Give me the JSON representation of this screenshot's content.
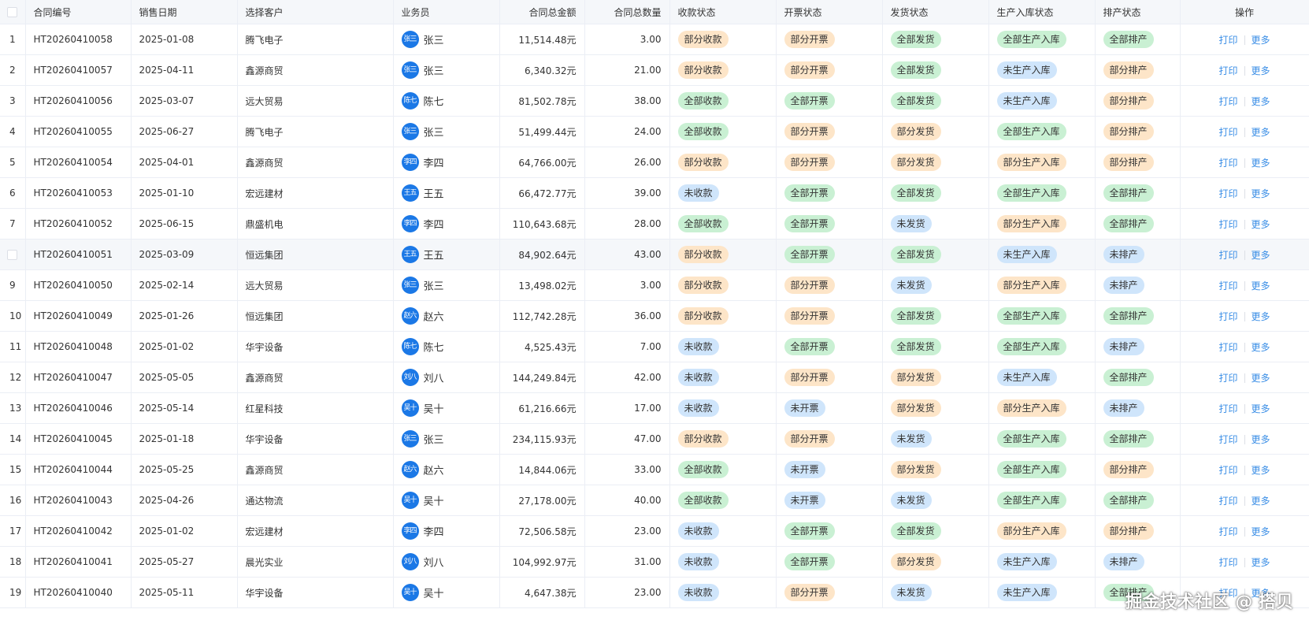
{
  "columns": {
    "contract_no": "合同编号",
    "sale_date": "销售日期",
    "customer": "选择客户",
    "salesperson": "业务员",
    "total_amount": "合同总金额",
    "total_qty": "合同总数量",
    "payment_status": "收款状态",
    "invoice_status": "开票状态",
    "shipping_status": "发货状态",
    "production_status": "生产入库状态",
    "schedule_status": "排产状态",
    "operations": "操作"
  },
  "actions": {
    "print": "打印",
    "more": "更多"
  },
  "status_colors": {
    "orange": "#fde5c8",
    "green": "#c9f0d3",
    "blue": "#cfe5fb",
    "link": "#3a8ee6",
    "avatar": "#1b78e6"
  },
  "rows": [
    {
      "idx": "1",
      "no": "HT20260410058",
      "date": "2025-01-08",
      "customer": "腾飞电子",
      "rep": "张三",
      "amount": "11,514.48元",
      "qty": "3.00",
      "pay": "部分收款",
      "inv": "部分开票",
      "ship": "全部发货",
      "prod": "全部生产入库",
      "sched": "全部排产"
    },
    {
      "idx": "2",
      "no": "HT20260410057",
      "date": "2025-04-11",
      "customer": "鑫源商贸",
      "rep": "张三",
      "amount": "6,340.32元",
      "qty": "21.00",
      "pay": "部分收款",
      "inv": "部分开票",
      "ship": "全部发货",
      "prod": "未生产入库",
      "sched": "部分排产"
    },
    {
      "idx": "3",
      "no": "HT20260410056",
      "date": "2025-03-07",
      "customer": "远大贸易",
      "rep": "陈七",
      "amount": "81,502.78元",
      "qty": "38.00",
      "pay": "全部收款",
      "inv": "全部开票",
      "ship": "全部发货",
      "prod": "未生产入库",
      "sched": "部分排产"
    },
    {
      "idx": "4",
      "no": "HT20260410055",
      "date": "2025-06-27",
      "customer": "腾飞电子",
      "rep": "张三",
      "amount": "51,499.44元",
      "qty": "24.00",
      "pay": "全部收款",
      "inv": "部分开票",
      "ship": "部分发货",
      "prod": "全部生产入库",
      "sched": "部分排产"
    },
    {
      "idx": "5",
      "no": "HT20260410054",
      "date": "2025-04-01",
      "customer": "鑫源商贸",
      "rep": "李四",
      "amount": "64,766.00元",
      "qty": "26.00",
      "pay": "部分收款",
      "inv": "部分开票",
      "ship": "部分发货",
      "prod": "部分生产入库",
      "sched": "部分排产"
    },
    {
      "idx": "6",
      "no": "HT20260410053",
      "date": "2025-01-10",
      "customer": "宏远建材",
      "rep": "王五",
      "amount": "66,472.77元",
      "qty": "39.00",
      "pay": "未收款",
      "inv": "全部开票",
      "ship": "全部发货",
      "prod": "全部生产入库",
      "sched": "全部排产"
    },
    {
      "idx": "7",
      "no": "HT20260410052",
      "date": "2025-06-15",
      "customer": "鼎盛机电",
      "rep": "李四",
      "amount": "110,643.68元",
      "qty": "28.00",
      "pay": "全部收款",
      "inv": "全部开票",
      "ship": "未发货",
      "prod": "部分生产入库",
      "sched": "全部排产"
    },
    {
      "idx": "",
      "no": "HT20260410051",
      "date": "2025-03-09",
      "customer": "恒远集团",
      "rep": "王五",
      "amount": "84,902.64元",
      "qty": "43.00",
      "pay": "部分收款",
      "inv": "全部开票",
      "ship": "全部发货",
      "prod": "未生产入库",
      "sched": "未排产",
      "checkbox": true
    },
    {
      "idx": "9",
      "no": "HT20260410050",
      "date": "2025-02-14",
      "customer": "远大贸易",
      "rep": "张三",
      "amount": "13,498.02元",
      "qty": "3.00",
      "pay": "部分收款",
      "inv": "部分开票",
      "ship": "未发货",
      "prod": "部分生产入库",
      "sched": "未排产"
    },
    {
      "idx": "10",
      "no": "HT20260410049",
      "date": "2025-01-26",
      "customer": "恒远集团",
      "rep": "赵六",
      "amount": "112,742.28元",
      "qty": "36.00",
      "pay": "部分收款",
      "inv": "部分开票",
      "ship": "全部发货",
      "prod": "全部生产入库",
      "sched": "全部排产"
    },
    {
      "idx": "11",
      "no": "HT20260410048",
      "date": "2025-01-02",
      "customer": "华宇设备",
      "rep": "陈七",
      "amount": "4,525.43元",
      "qty": "7.00",
      "pay": "未收款",
      "inv": "全部开票",
      "ship": "全部发货",
      "prod": "全部生产入库",
      "sched": "未排产"
    },
    {
      "idx": "12",
      "no": "HT20260410047",
      "date": "2025-05-05",
      "customer": "鑫源商贸",
      "rep": "刘八",
      "amount": "144,249.84元",
      "qty": "42.00",
      "pay": "未收款",
      "inv": "部分开票",
      "ship": "部分发货",
      "prod": "未生产入库",
      "sched": "全部排产"
    },
    {
      "idx": "13",
      "no": "HT20260410046",
      "date": "2025-05-14",
      "customer": "红星科技",
      "rep": "吴十",
      "amount": "61,216.66元",
      "qty": "17.00",
      "pay": "未收款",
      "inv": "未开票",
      "ship": "部分发货",
      "prod": "部分生产入库",
      "sched": "未排产"
    },
    {
      "idx": "14",
      "no": "HT20260410045",
      "date": "2025-01-18",
      "customer": "华宇设备",
      "rep": "张三",
      "amount": "234,115.93元",
      "qty": "47.00",
      "pay": "部分收款",
      "inv": "部分开票",
      "ship": "未发货",
      "prod": "全部生产入库",
      "sched": "全部排产"
    },
    {
      "idx": "15",
      "no": "HT20260410044",
      "date": "2025-05-25",
      "customer": "鑫源商贸",
      "rep": "赵六",
      "amount": "14,844.06元",
      "qty": "33.00",
      "pay": "全部收款",
      "inv": "未开票",
      "ship": "部分发货",
      "prod": "全部生产入库",
      "sched": "部分排产"
    },
    {
      "idx": "16",
      "no": "HT20260410043",
      "date": "2025-04-26",
      "customer": "通达物流",
      "rep": "吴十",
      "amount": "27,178.00元",
      "qty": "40.00",
      "pay": "全部收款",
      "inv": "未开票",
      "ship": "未发货",
      "prod": "全部生产入库",
      "sched": "全部排产"
    },
    {
      "idx": "17",
      "no": "HT20260410042",
      "date": "2025-01-02",
      "customer": "宏远建材",
      "rep": "李四",
      "amount": "72,506.58元",
      "qty": "23.00",
      "pay": "未收款",
      "inv": "全部开票",
      "ship": "全部发货",
      "prod": "部分生产入库",
      "sched": "部分排产"
    },
    {
      "idx": "18",
      "no": "HT20260410041",
      "date": "2025-05-27",
      "customer": "晨光实业",
      "rep": "刘八",
      "amount": "104,992.97元",
      "qty": "31.00",
      "pay": "未收款",
      "inv": "全部开票",
      "ship": "部分发货",
      "prod": "未生产入库",
      "sched": "未排产"
    },
    {
      "idx": "19",
      "no": "HT20260410040",
      "date": "2025-05-11",
      "customer": "华宇设备",
      "rep": "吴十",
      "amount": "4,647.38元",
      "qty": "23.00",
      "pay": "未收款",
      "inv": "部分开票",
      "ship": "未发货",
      "prod": "未生产入库",
      "sched": "全部排产"
    }
  ],
  "watermark": "掘金技术社区 @ 搭贝"
}
